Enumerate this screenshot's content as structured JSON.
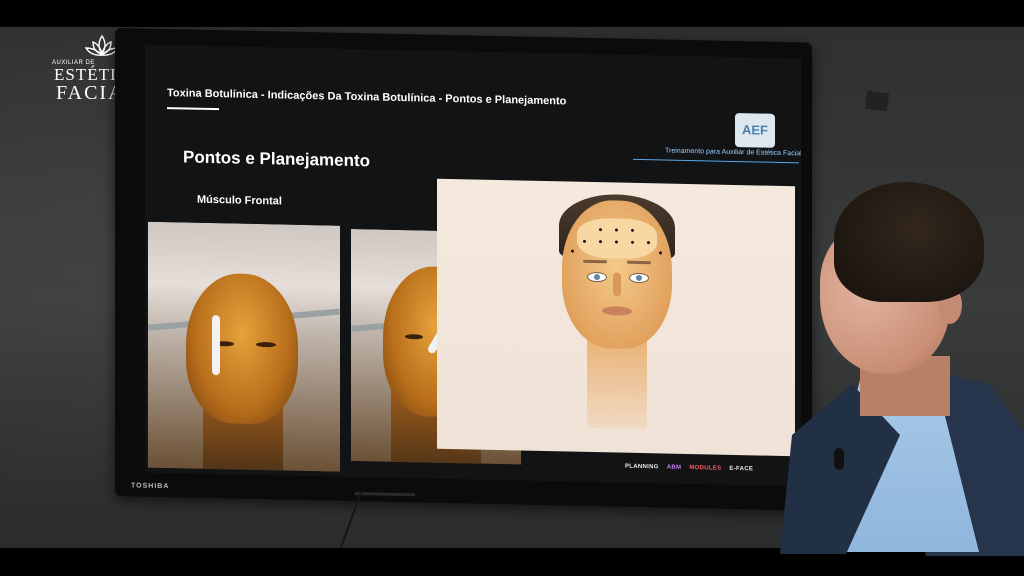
{
  "logo": {
    "line1": "AUXILIAR DE",
    "line2": "ESTÉTICA",
    "line3": "FACIAL"
  },
  "tv": {
    "brand": "TOSHIBA"
  },
  "slide": {
    "breadcrumb": "Toxina Botulínica - Indicações Da Toxina Botulínica - Pontos e Planejamento",
    "subtitle": "Treinamento para Auxiliar de Estética Facial",
    "badge": "AEF",
    "heading": "Pontos e Planejamento",
    "section": "Músculo Frontal",
    "sponsors": [
      "PLANNING",
      "ABM",
      "MODULES",
      "E-FACE"
    ]
  },
  "colors": {
    "slide_background": "#121314",
    "accent_blue": "#5aa7e8",
    "badge_background": "#dfe7ee"
  }
}
